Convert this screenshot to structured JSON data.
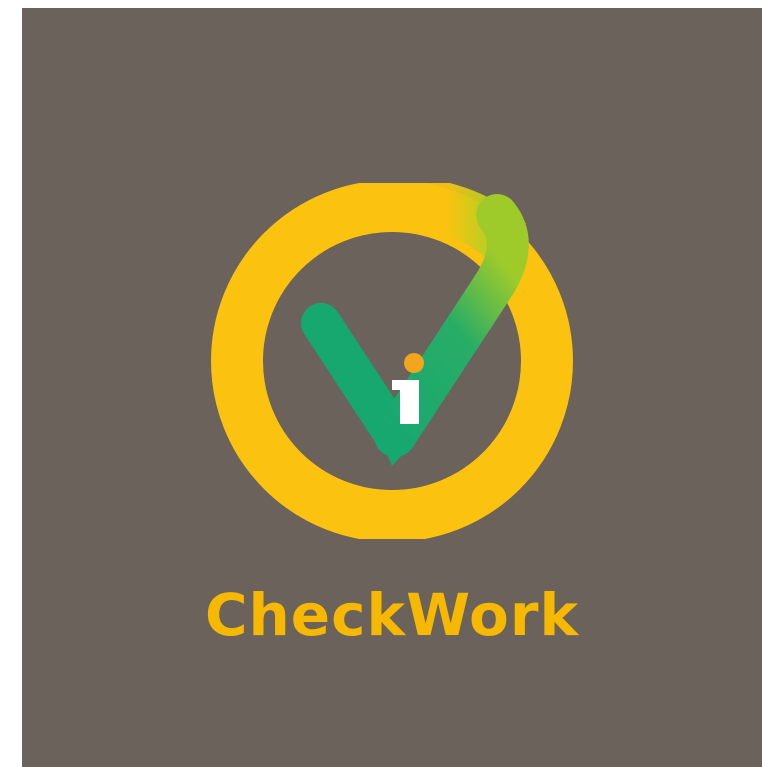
{
  "brand": {
    "name": "CheckWork"
  },
  "colors": {
    "background": "#6a625b",
    "ring_yellow": "#fcc210",
    "check_green": "#17a870",
    "check_light_green": "#a6cd1e",
    "wordmark": "#f6b800",
    "letter_i": "#ffffff",
    "dot": "#f4a51e"
  },
  "icons": {
    "logo": "checkmark-in-ring-icon"
  }
}
